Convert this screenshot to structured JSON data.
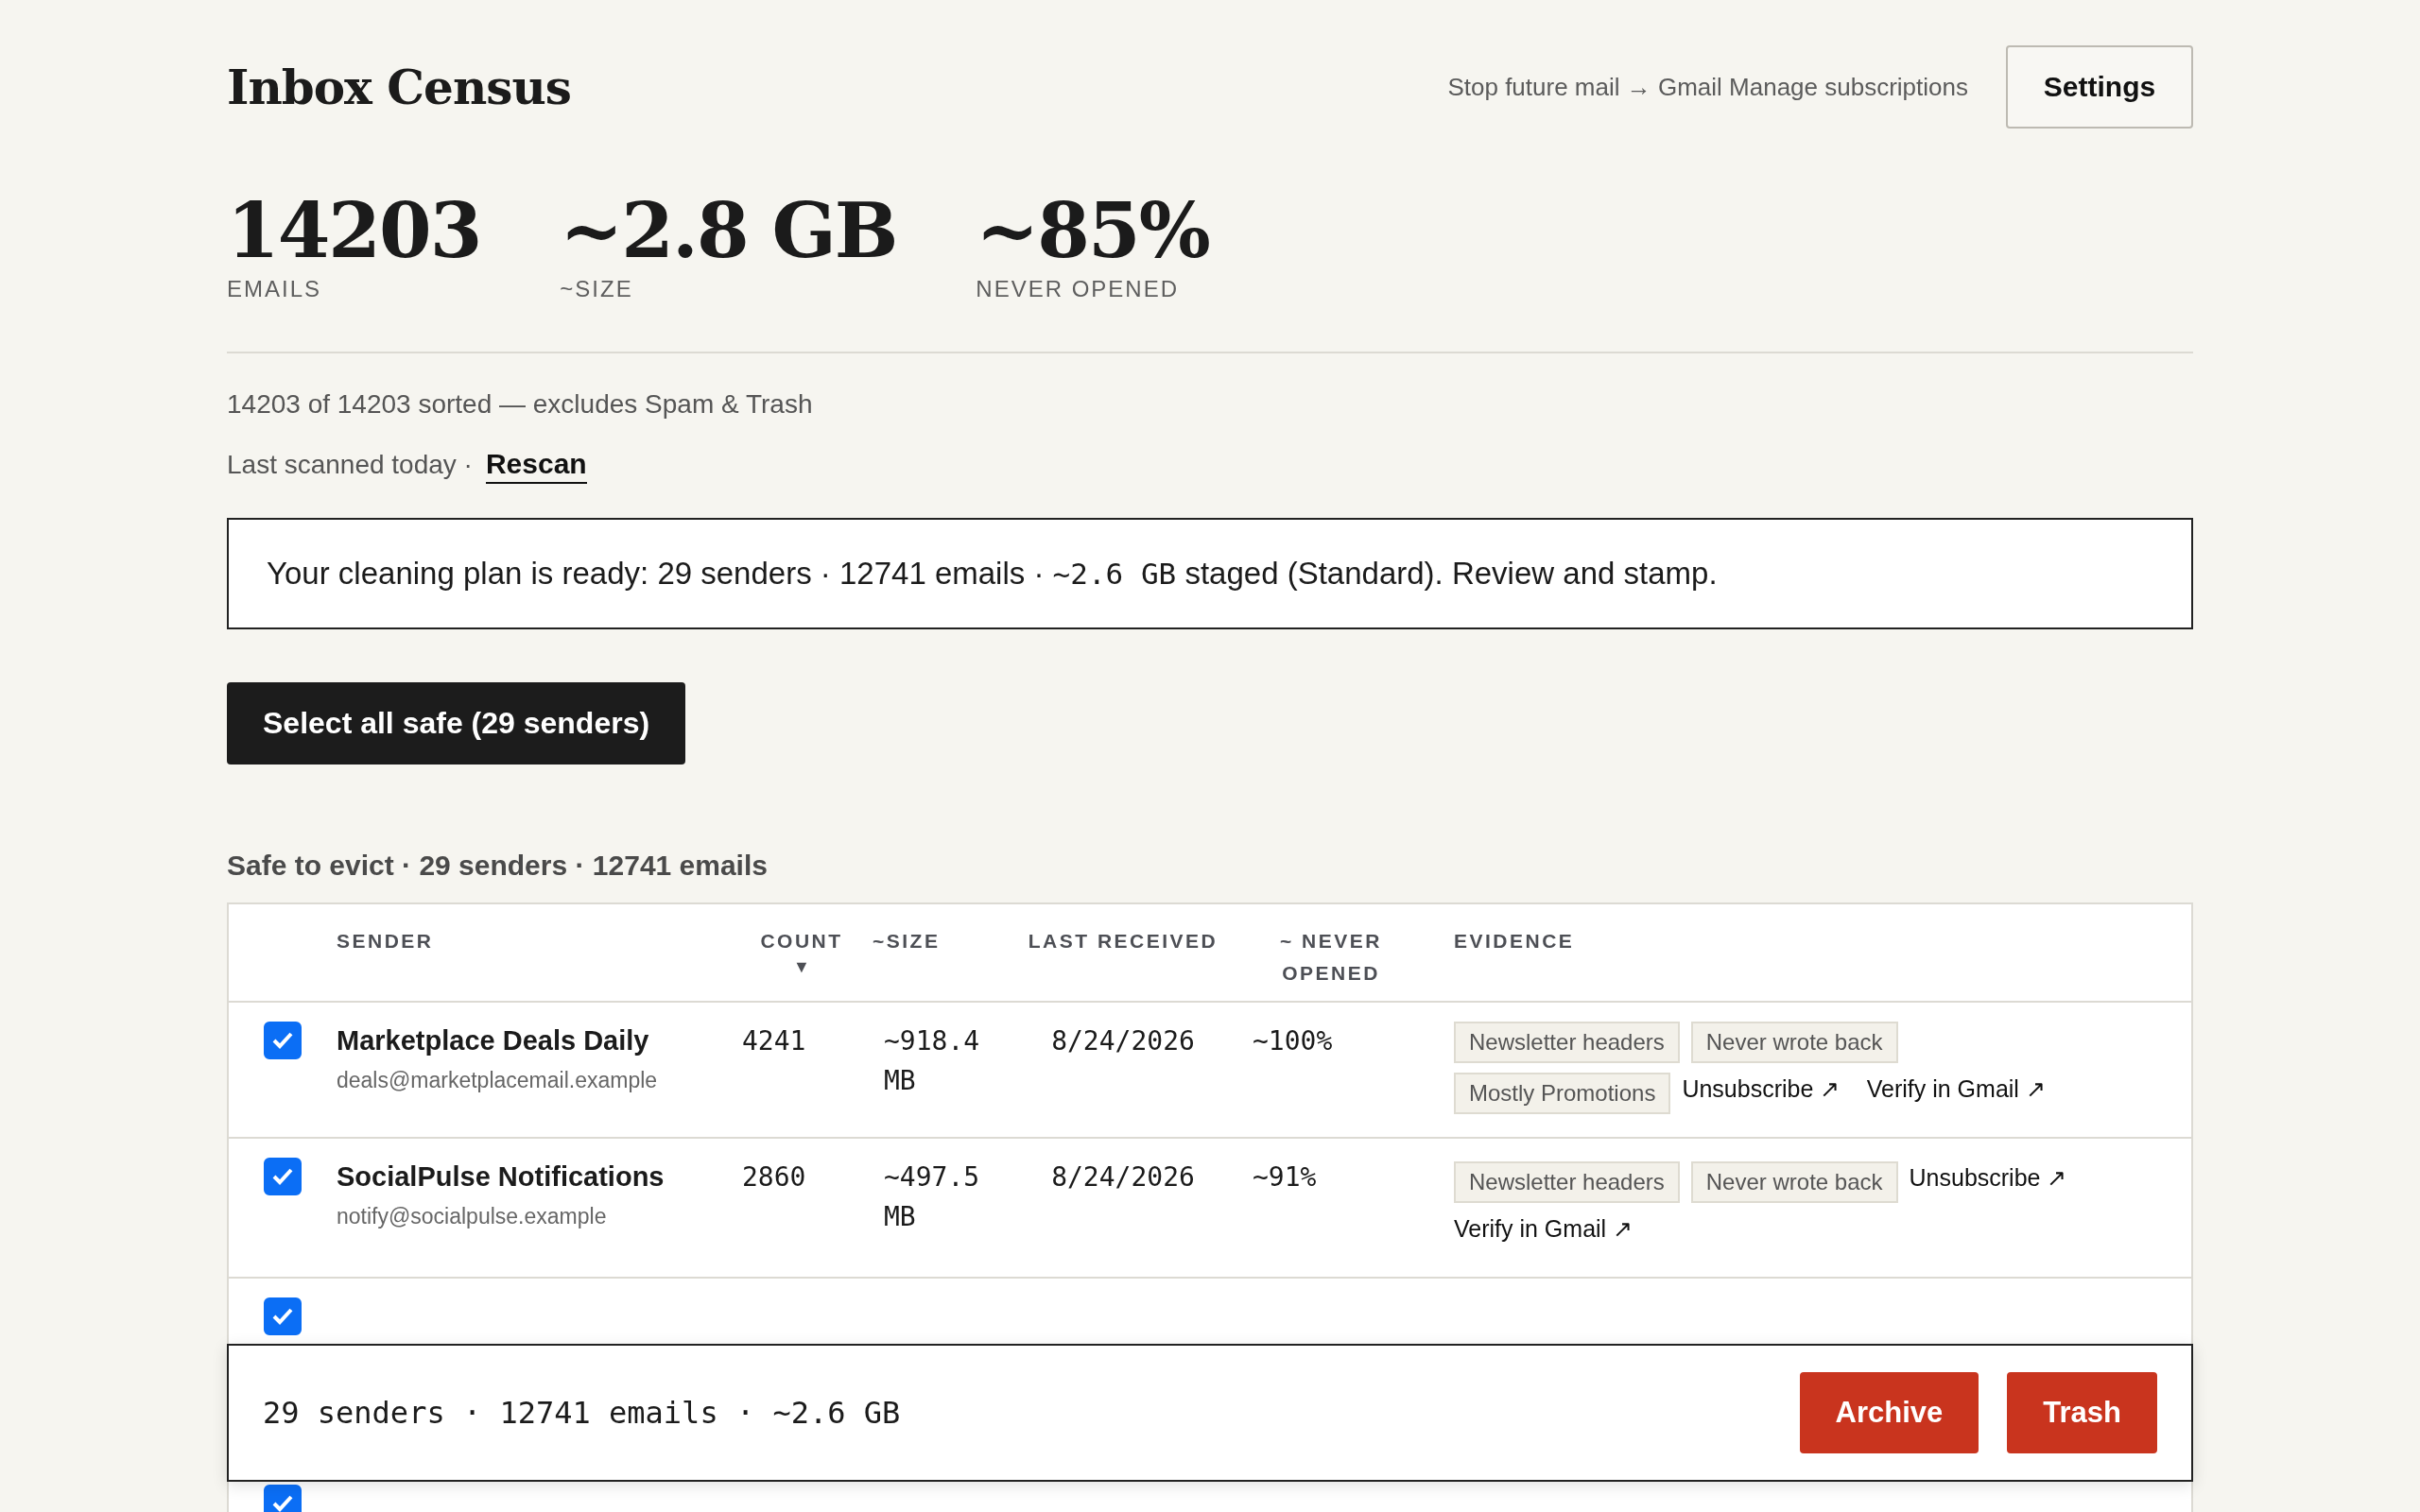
{
  "header": {
    "title": "Inbox Census",
    "nav_link": "Stop future mail → Gmail Manage subscriptions",
    "settings_button": "Settings"
  },
  "stats": [
    {
      "value": "14203",
      "label": "EMAILS"
    },
    {
      "value": "~2.8 GB",
      "label": "~SIZE"
    },
    {
      "value": "~85%",
      "label": "NEVER OPENED"
    }
  ],
  "sorted_note": "14203 of 14203 sorted — excludes Spam & Trash",
  "scan": {
    "text": "Last scanned today ·",
    "link": "Rescan"
  },
  "banner": {
    "text_before": "Your cleaning plan is ready: 29 senders · 12741 emails · ",
    "mono": "~2.6 GB",
    "text_after": " staged (Standard). Review and stamp."
  },
  "select_button": "Select all safe (29 senders)",
  "section_title": "Safe to evict · 29 senders · 12741 emails",
  "table": {
    "columns": [
      {
        "label": "SENDER"
      },
      {
        "label": "COUNT",
        "sort": "▼"
      },
      {
        "label": "~SIZE"
      },
      {
        "label": "LAST RECEIVED"
      },
      {
        "label": "~ NEVER OPENED"
      },
      {
        "label": "EVIDENCE"
      }
    ],
    "rows": [
      {
        "selected": true,
        "name": "Marketplace Deals Daily",
        "email": "deals@marketplacemail.example",
        "count": "4241",
        "size": "~918.4 MB",
        "last_received": "8/24/2026",
        "never_opened": "~100%",
        "tags": [
          "Newsletter headers",
          "Never wrote back",
          "Mostly Promotions"
        ],
        "links": [
          "Unsubscribe ↗",
          "Verify in Gmail ↗"
        ]
      },
      {
        "selected": true,
        "name": "SocialPulse Notifications",
        "email": "notify@socialpulse.example",
        "count": "2860",
        "size": "~497.5 MB",
        "last_received": "8/24/2026",
        "never_opened": "~91%",
        "tags": [
          "Newsletter headers",
          "Never wrote back"
        ],
        "links": [
          "Unsubscribe ↗",
          "Verify in Gmail ↗"
        ]
      },
      {
        "selected": true
      },
      {
        "selected": true
      }
    ]
  },
  "action_bar": {
    "summary": "29 senders · 12741 emails · ~2.6 GB",
    "buttons": [
      "Archive",
      "Trash"
    ]
  }
}
